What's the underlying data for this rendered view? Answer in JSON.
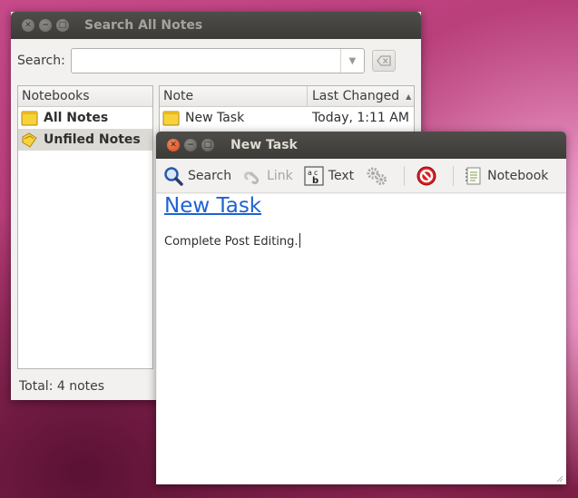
{
  "search_window": {
    "title": "Search All Notes",
    "search": {
      "label": "Search:",
      "value": "",
      "placeholder": ""
    },
    "notebooks": {
      "header": "Notebooks",
      "items": [
        {
          "label": "All Notes",
          "icon": "notebook-icon"
        },
        {
          "label": "Unfiled Notes",
          "icon": "unfiled-notebook-icon"
        }
      ],
      "selected": "Unfiled Notes"
    },
    "notes": {
      "columns": [
        "Note",
        "Last Changed"
      ],
      "sort_column": "Last Changed",
      "sort_direction": "ascending",
      "rows": [
        {
          "title": "New Task",
          "last_changed": "Today, 1:11 AM"
        }
      ]
    },
    "total": "Total: 4 notes"
  },
  "note_window": {
    "title": "New Task",
    "toolbar": {
      "search": "Search",
      "link": "Link",
      "text": "Text",
      "notebook": "Notebook"
    },
    "note": {
      "title": "New Task",
      "body": "Complete Post Editing."
    }
  },
  "colors": {
    "titlebar": "#3c3b37",
    "close_button": "#d8461d",
    "link_blue": "#1e63d2",
    "selection": "#dcdad5"
  }
}
